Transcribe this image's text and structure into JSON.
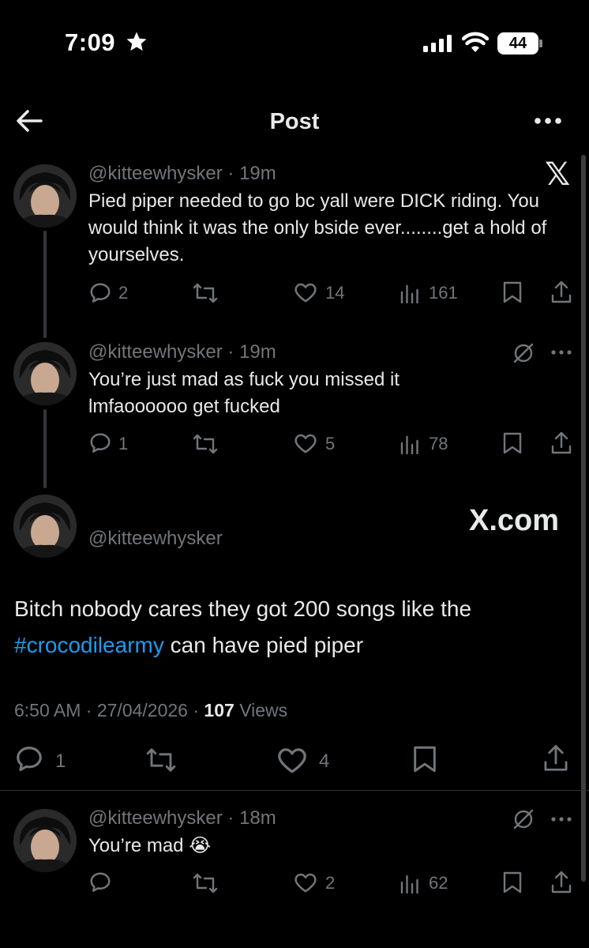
{
  "status_bar": {
    "time": "7:09",
    "battery": "44"
  },
  "header": {
    "title": "Post"
  },
  "tweets": [
    {
      "handle": "@kitteewhysker",
      "time": "19m",
      "text": "Pied piper needed to go bc yall were DICK riding. You would think it was the only bside ever........get a hold of yourselves.",
      "replies": "2",
      "likes": "14",
      "views": "161"
    },
    {
      "handle": "@kitteewhysker",
      "time": "19m",
      "text": "You’re just mad as fuck you missed it lmfaoooooo get fucked",
      "replies": "1",
      "likes": "5",
      "views": "78"
    }
  ],
  "main_post": {
    "handle": "@kitteewhysker",
    "source_badge": "X.com",
    "text_before": "Bitch nobody cares they got 200 songs like the ",
    "hashtag": "#crocodilearmy",
    "text_after": " can have pied piper",
    "time": "6:50 AM",
    "date": "27/04/2026",
    "views_count": "107",
    "views_label": "Views",
    "replies": "1",
    "likes": "4"
  },
  "reply": {
    "handle": "@kitteewhysker",
    "time": "18m",
    "text": "You’re mad",
    "emoji": "😭",
    "likes": "2",
    "views": "62"
  },
  "icons": {
    "x_logo": "x-logo-icon",
    "grok": "grok-icon",
    "more": "more-icon"
  },
  "colors": {
    "background": "#000000",
    "text": "#e7e9ea",
    "muted": "#71767b",
    "link": "#1d9bf0"
  }
}
